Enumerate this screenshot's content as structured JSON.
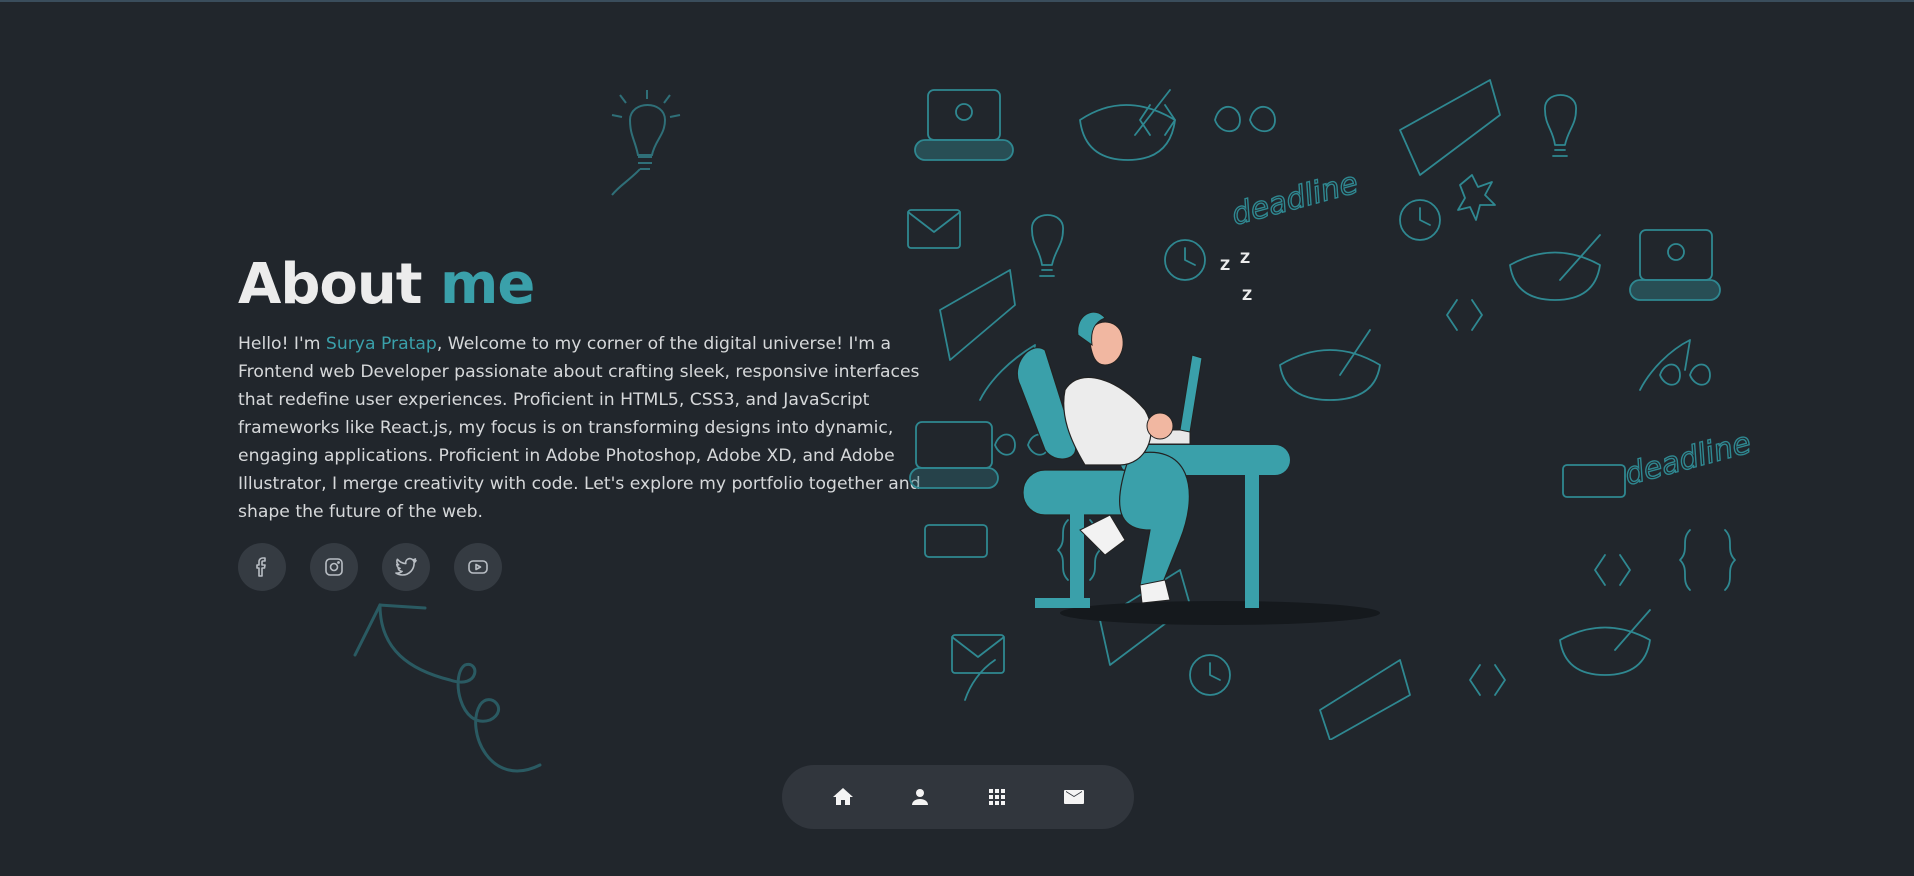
{
  "hero": {
    "title_main": "About",
    "title_accent": "me",
    "bio_prefix": "Hello! I'm ",
    "bio_name": "Surya Pratap",
    "bio_rest": ", Welcome to my corner of the digital universe! I'm a Frontend web Developer passionate about crafting sleek, responsive interfaces that redefine user experiences. Proficient in HTML5, CSS3, and JavaScript frameworks like React.js, my focus is on transforming designs into dynamic, engaging applications. Proficient in Adobe Photoshop, Adobe XD, and Adobe Illustrator, I merge creativity with code. Let's explore my portfolio together and shape the future of the web."
  },
  "socials": [
    {
      "icon": "facebook-icon"
    },
    {
      "icon": "instagram-icon"
    },
    {
      "icon": "twitter-icon"
    },
    {
      "icon": "youtube-icon"
    }
  ],
  "navbar": [
    {
      "icon": "home-icon"
    },
    {
      "icon": "user-icon"
    },
    {
      "icon": "grid-icon"
    },
    {
      "icon": "mail-icon"
    }
  ],
  "illustration": {
    "doodle_words": [
      "deadline",
      "deadline"
    ],
    "sleep_letters": [
      "Z",
      "Z",
      "Z"
    ]
  },
  "colors": {
    "background": "#21262c",
    "accent": "#3aa0aa",
    "text": "#d6d8da",
    "title": "#ececec",
    "button_bg": "#353b42",
    "navbar_bg": "#31363d"
  }
}
